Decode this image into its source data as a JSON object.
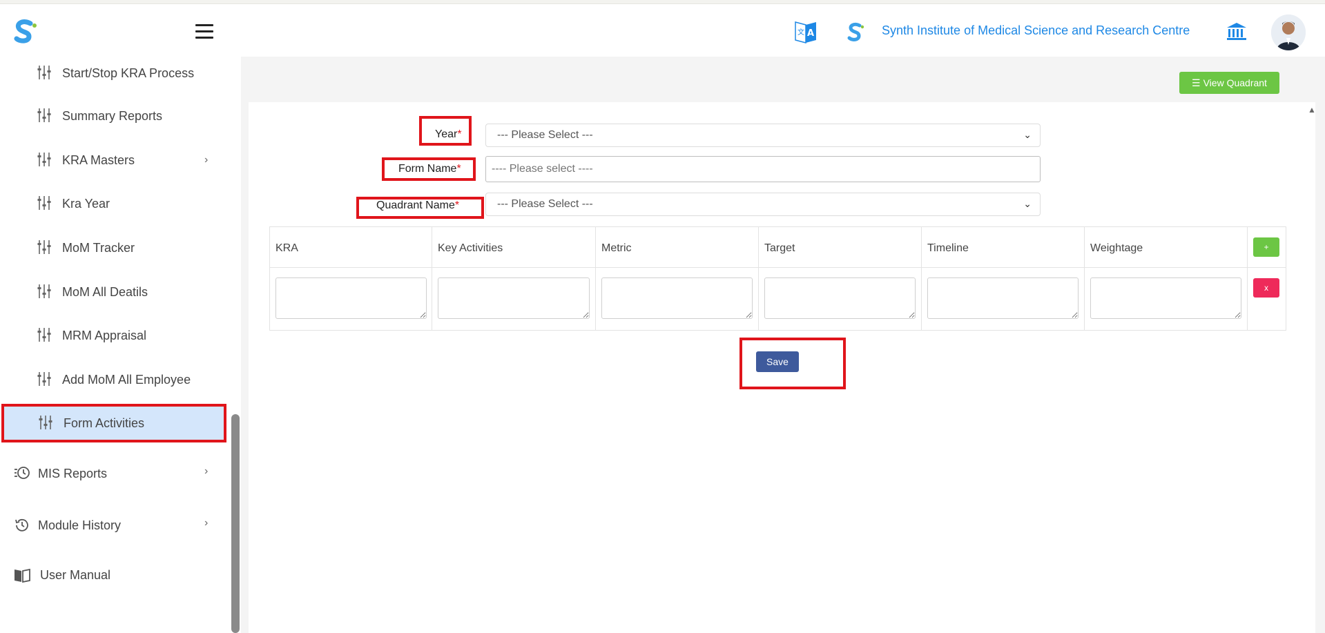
{
  "header": {
    "institute_name": "Synth Institute of Medical Science and Research Centre"
  },
  "sidebar": {
    "items": [
      {
        "label": "Start/Stop KRA Process"
      },
      {
        "label": "Summary Reports"
      },
      {
        "label": "KRA Masters"
      },
      {
        "label": "Kra Year"
      },
      {
        "label": "MoM Tracker"
      },
      {
        "label": "MoM All Deatils"
      },
      {
        "label": "MRM Appraisal"
      },
      {
        "label": "Add MoM All Employee"
      },
      {
        "label": "Form Activities"
      }
    ],
    "main_items": [
      {
        "label": "MIS Reports"
      },
      {
        "label": "Module History"
      },
      {
        "label": "User Manual"
      }
    ]
  },
  "toolbar": {
    "view_quadrant_label": "View Quadrant"
  },
  "form": {
    "year_label": "Year",
    "form_name_label": "Form Name",
    "quadrant_name_label": "Quadrant Name",
    "required_mark": "*",
    "year_value": "--- Please Select ---",
    "form_name_placeholder": "---- Please select ----",
    "quadrant_value": "--- Please Select ---"
  },
  "table": {
    "columns": [
      "KRA",
      "Key Activities",
      "Metric",
      "Target",
      "Timeline",
      "Weightage"
    ],
    "add_label": "+",
    "remove_label": "x"
  },
  "actions": {
    "save_label": "Save"
  },
  "colors": {
    "accent_blue": "#1e88e5",
    "highlight_red": "#e0151b",
    "add_green": "#6cc644",
    "remove_pink": "#ee2a5a",
    "save_blue": "#3e5a9c",
    "active_item_bg": "#d4e6fb"
  }
}
